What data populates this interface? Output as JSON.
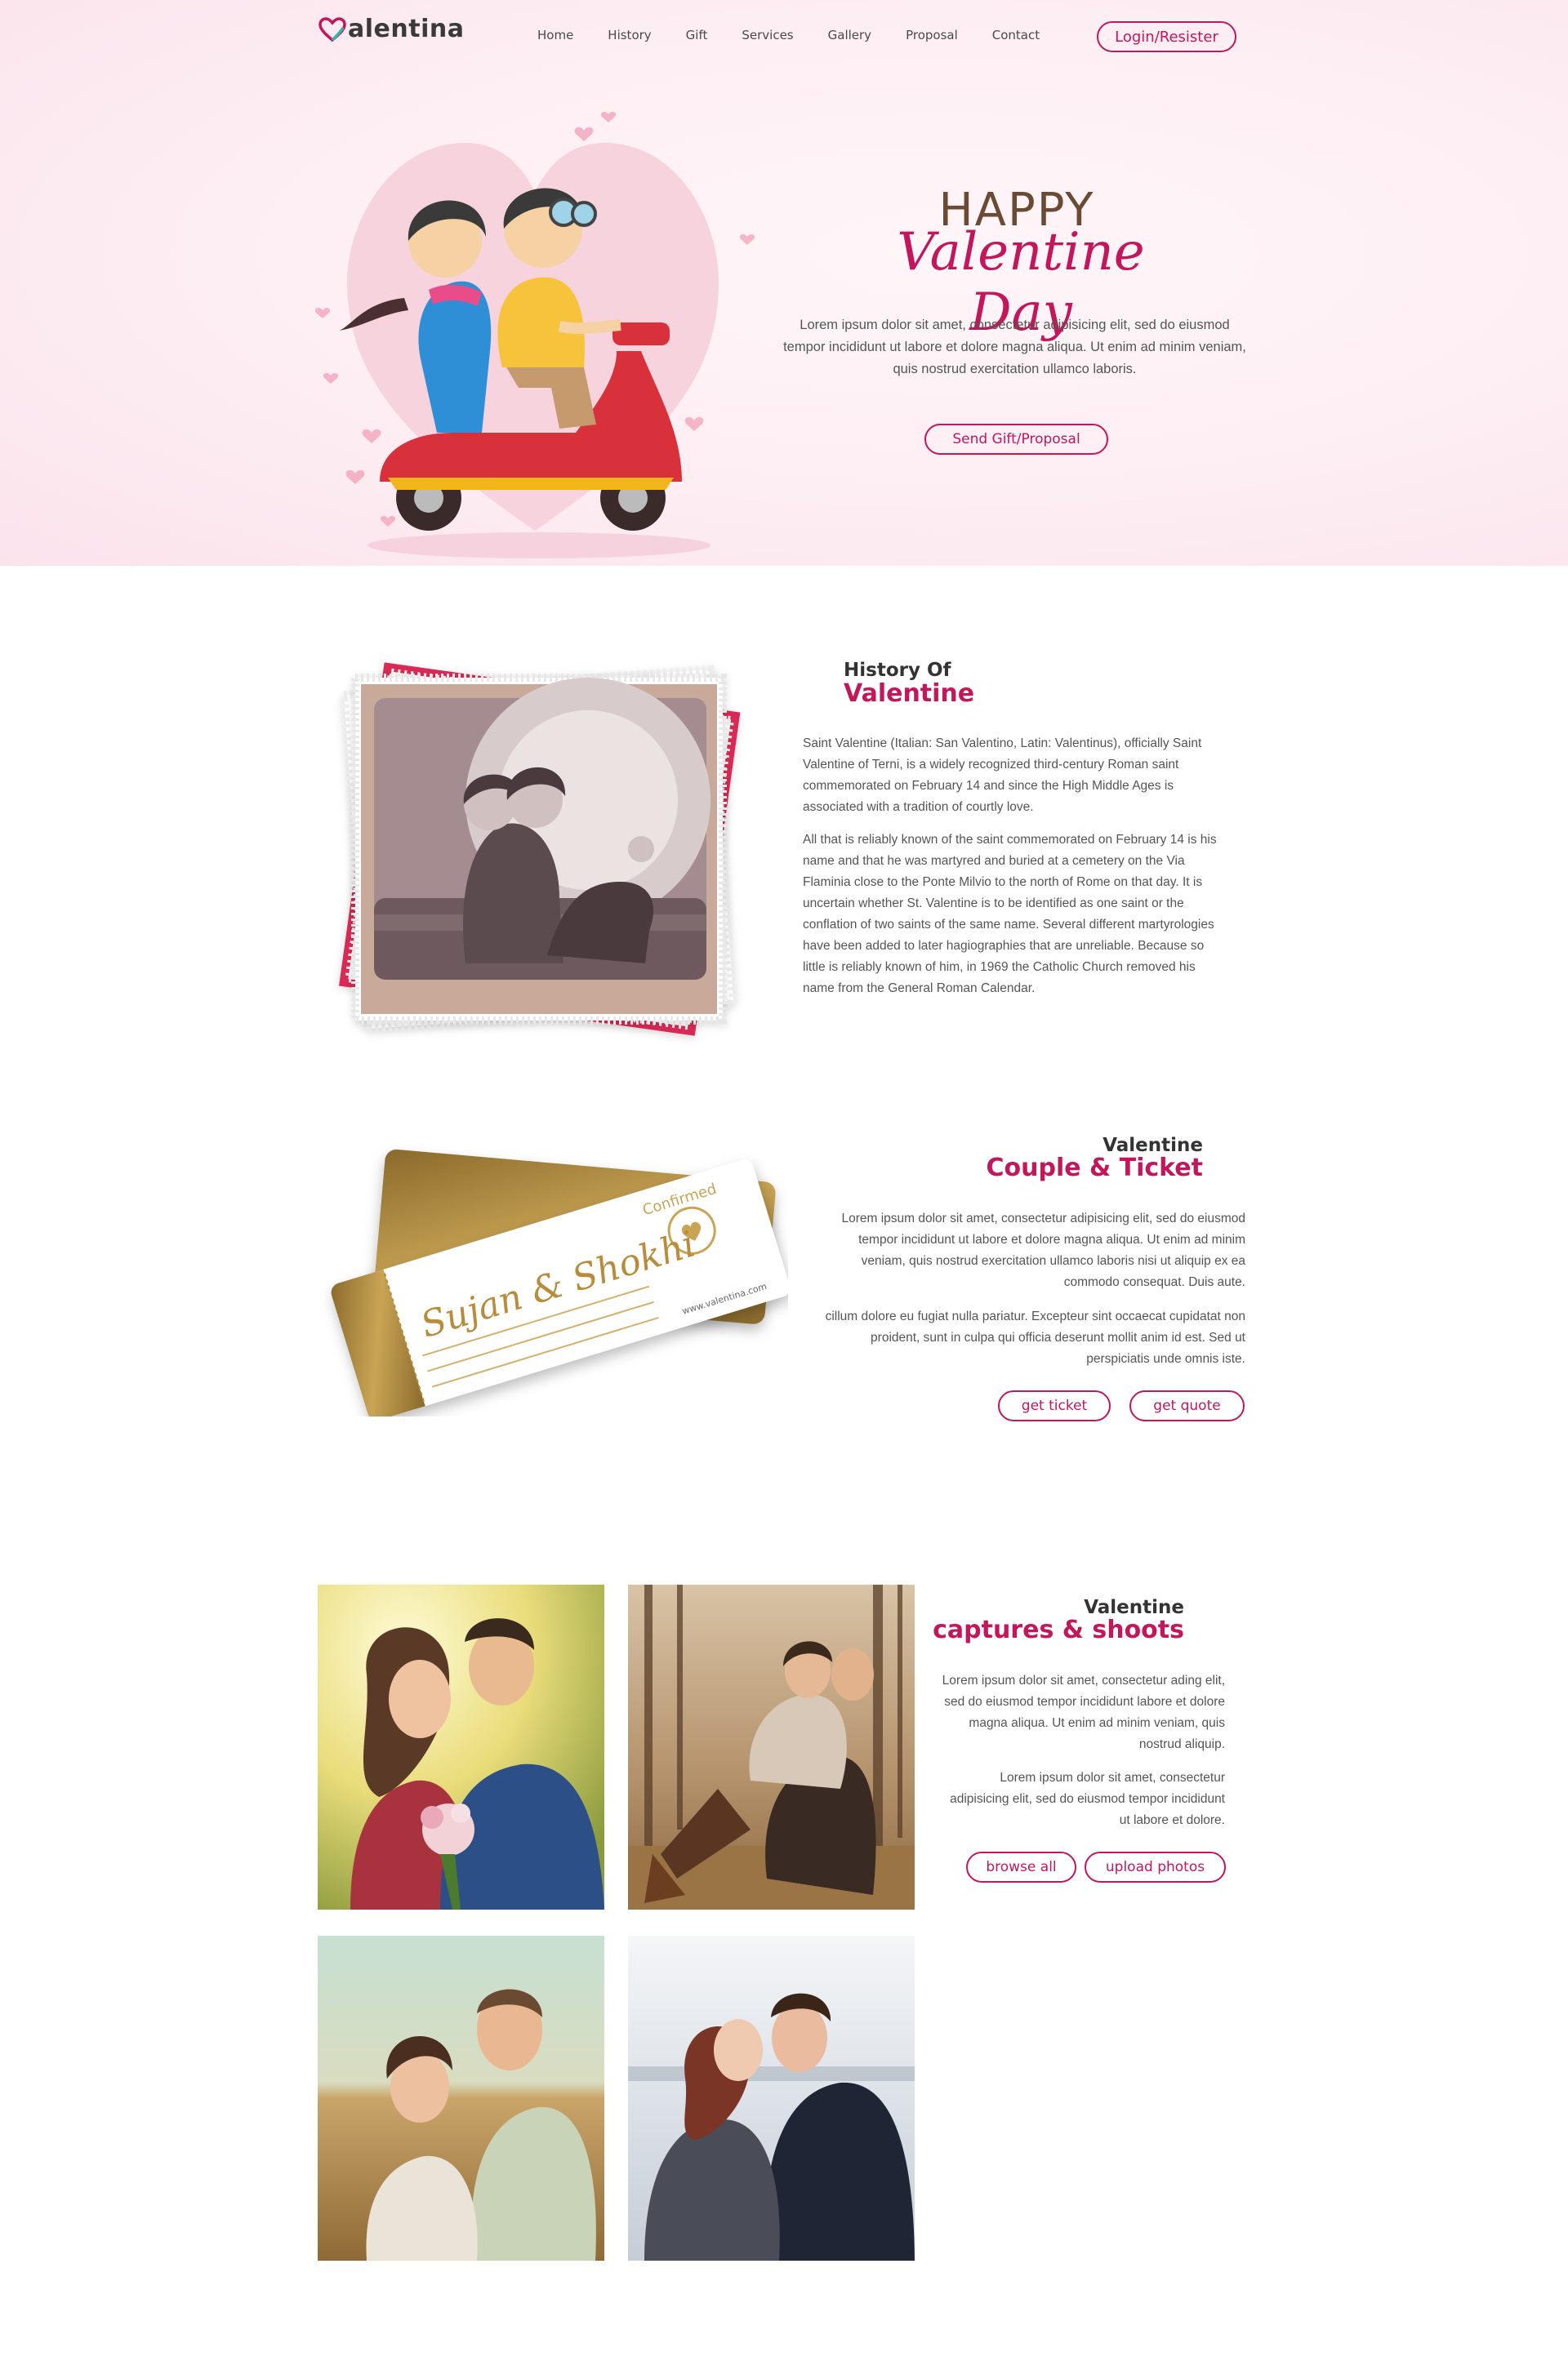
{
  "header": {
    "logo_text": "alentina",
    "nav": [
      "Home",
      "History",
      "Gift",
      "Services",
      "Gallery",
      "Proposal",
      "Contact"
    ],
    "login_label": "Login/Resister"
  },
  "hero": {
    "happy": "HAPPY",
    "script": "Valentine Day",
    "text": "Lorem ipsum dolor sit amet, consectetur adipisicing elit, sed do eiusmod tempor incididunt ut labore et dolore magna aliqua. Ut enim ad minim veniam, quis nostrud exercitation ullamco laboris.",
    "button": "Send Gift/Proposal"
  },
  "history": {
    "sub": "History Of",
    "title": "Valentine",
    "p1": "Saint Valentine (Italian: San Valentino, Latin: Valentinus), officially Saint Valentine of Terni, is a widely recognized third-century Roman saint commemorated on February 14 and since the High Middle Ages is associated with a tradition of courtly love.",
    "p2": "All that is reliably known of the saint commemorated on February 14 is his name and that he was martyred and buried at a cemetery on the Via Flaminia close to the Ponte Milvio to the north of Rome on that day. It is uncertain whether St. Valentine is to be identified as one saint or the conflation of two saints of the same name. Several different martyrologies have been added to later hagiographies that are unreliable. Because so little is reliably known of him, in 1969 the Catholic Church removed his name from the General Roman Calendar."
  },
  "ticket": {
    "sub": "Valentine",
    "title": "Couple & Ticket",
    "p1": "Lorem ipsum dolor sit amet, consectetur adipisicing elit, sed do eiusmod tempor incididunt ut labore et dolore magna aliqua. Ut enim ad minim veniam, quis nostrud exercitation ullamco laboris nisi ut aliquip ex ea commodo consequat. Duis aute.",
    "p2": "cillum dolore eu fugiat nulla pariatur. Excepteur sint occaecat cupidatat non proident, sunt in culpa qui officia deserunt mollit anim id est. Sed ut perspiciatis unde omnis iste.",
    "btn_ticket": "get ticket",
    "btn_quote": "get quote",
    "card_names": "Sujan & Shokhi",
    "card_stamp": "Confirmed",
    "card_site": "www.valentina.com"
  },
  "captures": {
    "sub": "Valentine",
    "title": "captures & shoots",
    "p1": "Lorem ipsum dolor sit amet, consectetur ading elit, sed do eiusmod tempor incididunt labore et dolore magna aliqua. Ut enim ad minim veniam, quis nostrud aliquip.",
    "p2": "Lorem ipsum dolor sit amet, consectetur adipisicing elit, sed do eiusmod tempor incididunt ut labore et dolore.",
    "btn_browse": "browse all",
    "btn_upload": "upload photos"
  },
  "colors": {
    "accent": "#c4165a",
    "brown": "#6b4a33",
    "hero_bg": "#fdeef3"
  }
}
